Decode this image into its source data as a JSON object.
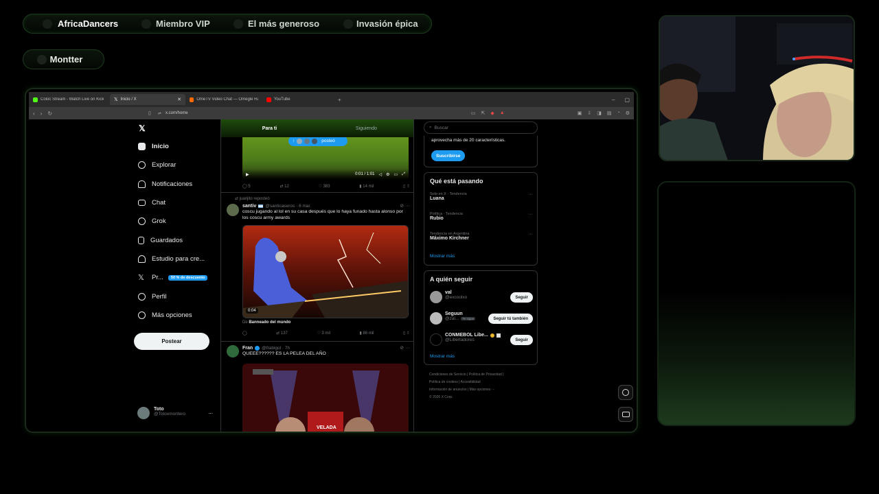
{
  "overlay": {
    "badges": [
      {
        "label": "AfricaDancers",
        "icon": "medal-icon",
        "color": "#ffffff"
      },
      {
        "label": "Miembro VIP",
        "icon": "crown-icon",
        "color": "#cfd6cf"
      },
      {
        "label": "El más generoso",
        "icon": "gift-icon",
        "color": "#cfd6cf"
      },
      {
        "label": "Invasión épica",
        "icon": "flag-icon",
        "color": "#cfd6cf"
      }
    ],
    "username": "Montter"
  },
  "browser": {
    "tabs": [
      {
        "label": "Coloc Stream - Watch Live on Kick",
        "favicon_color": "#53fc18"
      },
      {
        "label": "Inicio / X",
        "favicon_color": "#e7e9ea"
      },
      {
        "label": "OmeTV Video Chat — Omegle Rando",
        "favicon_color": "#ff6a00"
      },
      {
        "label": "YouTube",
        "favicon_color": "#ff0000"
      }
    ],
    "new_tab": "+",
    "url": "x.com/home"
  },
  "x": {
    "nav": [
      {
        "label": "Inicio",
        "icon": "home-icon"
      },
      {
        "label": "Explorar",
        "icon": "search-icon"
      },
      {
        "label": "Notificaciones",
        "icon": "bell-icon"
      },
      {
        "label": "Chat",
        "icon": "mail-icon"
      },
      {
        "label": "Grok",
        "icon": "grok-icon"
      },
      {
        "label": "Guardados",
        "icon": "bookmark-icon"
      },
      {
        "label": "Estudio para cre...",
        "icon": "creator-studio-icon"
      },
      {
        "label": "Pr...",
        "icon": "x-logo-icon",
        "badge": "50 % de descuento"
      },
      {
        "label": "Perfil",
        "icon": "person-icon"
      },
      {
        "label": "Más opciones",
        "icon": "more-circle-icon"
      }
    ],
    "post_button": "Postear",
    "account": {
      "name": "Toto",
      "handle": "@Totoxmontero",
      "more": "..."
    },
    "feed_tabs": [
      "Para ti",
      "Siguiendo"
    ],
    "new_posts_pill": "posteó",
    "video": {
      "time": "0:01 / 1:01"
    },
    "tweets": [
      {
        "actions": [
          "5",
          "12",
          "383",
          "14 mil"
        ]
      },
      {
        "repost_note": "juanjito reposteó",
        "name": "santiv",
        "handle": "@santicaseros · 6 mar.",
        "text": "coscu jugando al lol en su casa después que lo haya funado hasta alonso por los coscu army awards",
        "media_duration": "0:04",
        "from_label": "De",
        "from_source": "Banneado del mundo",
        "actions": [
          "",
          "137",
          "3 mil",
          "86 mil"
        ]
      },
      {
        "name": "Fran",
        "handle": "@frabigol · 7h",
        "text": "QUEEE?????? ES LA PELEA DEL AÑO",
        "media_label": "VELADA"
      }
    ],
    "search_placeholder": "Buscar",
    "premium": {
      "text": "aprovecha más de 20 características.",
      "button": "Suscribirse"
    },
    "trends": {
      "title": "Qué está pasando",
      "items": [
        {
          "context": "Solo en X · Tendencia",
          "name": "Luana"
        },
        {
          "context": "Política · Tendencia",
          "name": "Rubio"
        },
        {
          "context": "Tendencia en Argentina",
          "name": "Máximo Kirchner"
        }
      ],
      "more": "Mostrar más"
    },
    "who_to_follow": {
      "title": "A quién seguir",
      "items": [
        {
          "name": "val",
          "handle": "@excoolxo",
          "button": "Seguir"
        },
        {
          "name": "Seguun",
          "handle": "@zal...",
          "tag": "Te sigue",
          "button": "Seguir tú también"
        },
        {
          "name": "CONMEBOL Libe...",
          "handle": "@Libertadores",
          "button": "Seguir"
        }
      ],
      "more": "Mostrar más"
    },
    "footer": [
      "Condiciones de Servicio",
      "Política de Privacidad",
      "Política de cookies",
      "Accesibilidad",
      "Información de anuncios",
      "Más opciones ···",
      "© 2026 X Corp."
    ]
  }
}
